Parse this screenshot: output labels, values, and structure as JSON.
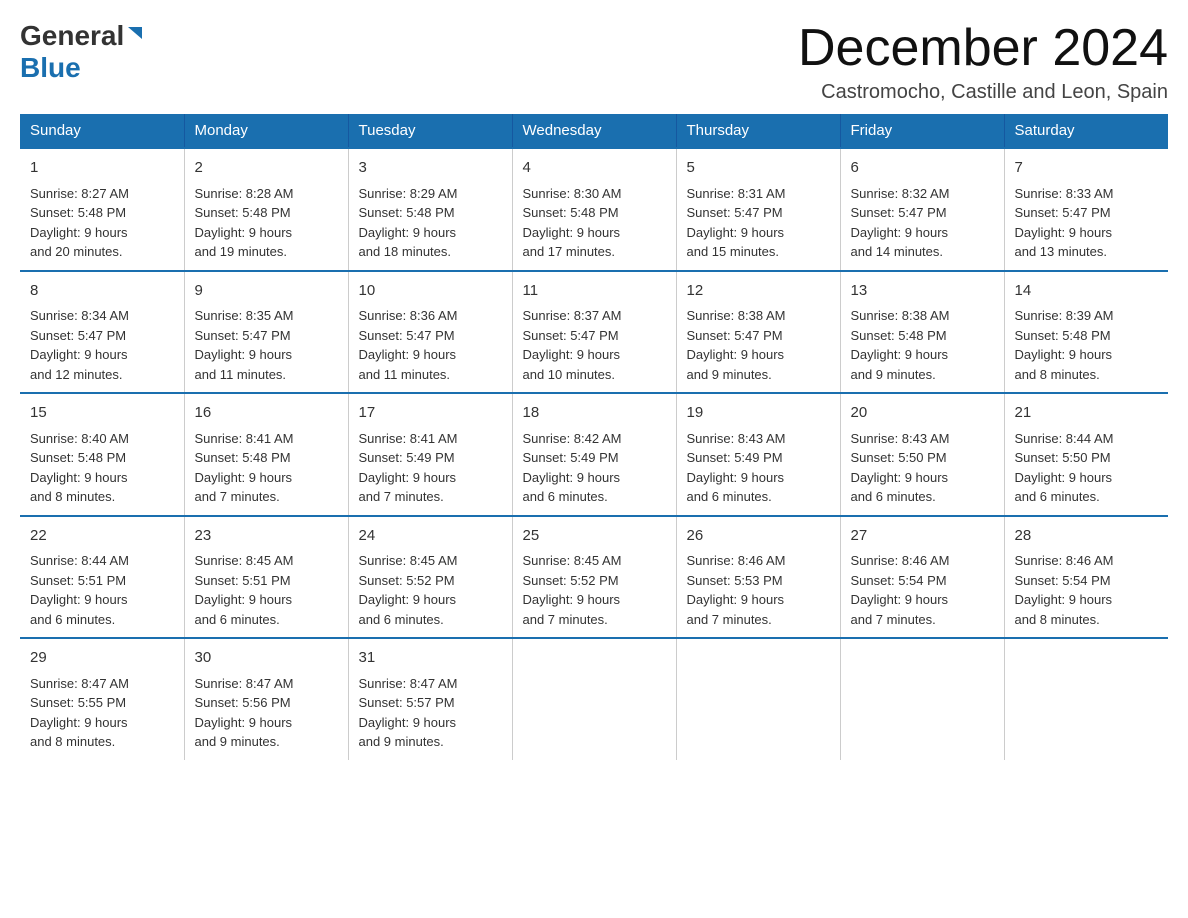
{
  "logo": {
    "general": "General",
    "blue": "Blue"
  },
  "title": "December 2024",
  "subtitle": "Castromocho, Castille and Leon, Spain",
  "weekdays": [
    "Sunday",
    "Monday",
    "Tuesday",
    "Wednesday",
    "Thursday",
    "Friday",
    "Saturday"
  ],
  "weeks": [
    [
      {
        "day": "1",
        "sunrise": "8:27 AM",
        "sunset": "5:48 PM",
        "daylight": "9 hours and 20 minutes."
      },
      {
        "day": "2",
        "sunrise": "8:28 AM",
        "sunset": "5:48 PM",
        "daylight": "9 hours and 19 minutes."
      },
      {
        "day": "3",
        "sunrise": "8:29 AM",
        "sunset": "5:48 PM",
        "daylight": "9 hours and 18 minutes."
      },
      {
        "day": "4",
        "sunrise": "8:30 AM",
        "sunset": "5:48 PM",
        "daylight": "9 hours and 17 minutes."
      },
      {
        "day": "5",
        "sunrise": "8:31 AM",
        "sunset": "5:47 PM",
        "daylight": "9 hours and 15 minutes."
      },
      {
        "day": "6",
        "sunrise": "8:32 AM",
        "sunset": "5:47 PM",
        "daylight": "9 hours and 14 minutes."
      },
      {
        "day": "7",
        "sunrise": "8:33 AM",
        "sunset": "5:47 PM",
        "daylight": "9 hours and 13 minutes."
      }
    ],
    [
      {
        "day": "8",
        "sunrise": "8:34 AM",
        "sunset": "5:47 PM",
        "daylight": "9 hours and 12 minutes."
      },
      {
        "day": "9",
        "sunrise": "8:35 AM",
        "sunset": "5:47 PM",
        "daylight": "9 hours and 11 minutes."
      },
      {
        "day": "10",
        "sunrise": "8:36 AM",
        "sunset": "5:47 PM",
        "daylight": "9 hours and 11 minutes."
      },
      {
        "day": "11",
        "sunrise": "8:37 AM",
        "sunset": "5:47 PM",
        "daylight": "9 hours and 10 minutes."
      },
      {
        "day": "12",
        "sunrise": "8:38 AM",
        "sunset": "5:47 PM",
        "daylight": "9 hours and 9 minutes."
      },
      {
        "day": "13",
        "sunrise": "8:38 AM",
        "sunset": "5:48 PM",
        "daylight": "9 hours and 9 minutes."
      },
      {
        "day": "14",
        "sunrise": "8:39 AM",
        "sunset": "5:48 PM",
        "daylight": "9 hours and 8 minutes."
      }
    ],
    [
      {
        "day": "15",
        "sunrise": "8:40 AM",
        "sunset": "5:48 PM",
        "daylight": "9 hours and 8 minutes."
      },
      {
        "day": "16",
        "sunrise": "8:41 AM",
        "sunset": "5:48 PM",
        "daylight": "9 hours and 7 minutes."
      },
      {
        "day": "17",
        "sunrise": "8:41 AM",
        "sunset": "5:49 PM",
        "daylight": "9 hours and 7 minutes."
      },
      {
        "day": "18",
        "sunrise": "8:42 AM",
        "sunset": "5:49 PM",
        "daylight": "9 hours and 6 minutes."
      },
      {
        "day": "19",
        "sunrise": "8:43 AM",
        "sunset": "5:49 PM",
        "daylight": "9 hours and 6 minutes."
      },
      {
        "day": "20",
        "sunrise": "8:43 AM",
        "sunset": "5:50 PM",
        "daylight": "9 hours and 6 minutes."
      },
      {
        "day": "21",
        "sunrise": "8:44 AM",
        "sunset": "5:50 PM",
        "daylight": "9 hours and 6 minutes."
      }
    ],
    [
      {
        "day": "22",
        "sunrise": "8:44 AM",
        "sunset": "5:51 PM",
        "daylight": "9 hours and 6 minutes."
      },
      {
        "day": "23",
        "sunrise": "8:45 AM",
        "sunset": "5:51 PM",
        "daylight": "9 hours and 6 minutes."
      },
      {
        "day": "24",
        "sunrise": "8:45 AM",
        "sunset": "5:52 PM",
        "daylight": "9 hours and 6 minutes."
      },
      {
        "day": "25",
        "sunrise": "8:45 AM",
        "sunset": "5:52 PM",
        "daylight": "9 hours and 7 minutes."
      },
      {
        "day": "26",
        "sunrise": "8:46 AM",
        "sunset": "5:53 PM",
        "daylight": "9 hours and 7 minutes."
      },
      {
        "day": "27",
        "sunrise": "8:46 AM",
        "sunset": "5:54 PM",
        "daylight": "9 hours and 7 minutes."
      },
      {
        "day": "28",
        "sunrise": "8:46 AM",
        "sunset": "5:54 PM",
        "daylight": "9 hours and 8 minutes."
      }
    ],
    [
      {
        "day": "29",
        "sunrise": "8:47 AM",
        "sunset": "5:55 PM",
        "daylight": "9 hours and 8 minutes."
      },
      {
        "day": "30",
        "sunrise": "8:47 AM",
        "sunset": "5:56 PM",
        "daylight": "9 hours and 9 minutes."
      },
      {
        "day": "31",
        "sunrise": "8:47 AM",
        "sunset": "5:57 PM",
        "daylight": "9 hours and 9 minutes."
      },
      null,
      null,
      null,
      null
    ]
  ],
  "labels": {
    "sunrise": "Sunrise:",
    "sunset": "Sunset:",
    "daylight": "Daylight:"
  }
}
